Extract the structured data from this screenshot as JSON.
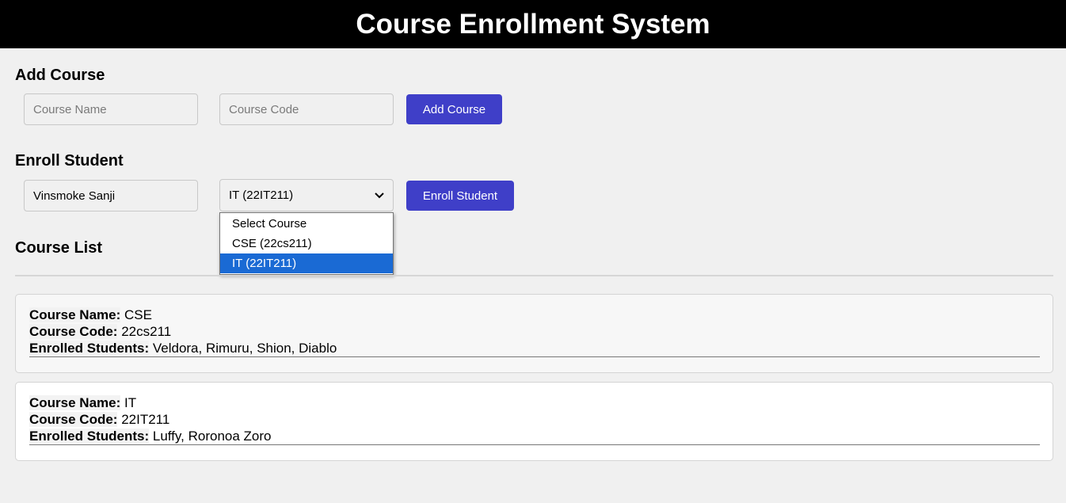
{
  "header": {
    "title": "Course Enrollment System"
  },
  "add_course": {
    "heading": "Add Course",
    "course_name_placeholder": "Course Name",
    "course_code_placeholder": "Course Code",
    "button_label": "Add Course"
  },
  "enroll": {
    "heading": "Enroll Student",
    "student_name_value": "Vinsmoke Sanji",
    "selected_course": "IT (22IT211)",
    "options": [
      "Select Course",
      "CSE (22cs211)",
      "IT (22IT211)"
    ],
    "button_label": "Enroll Student"
  },
  "course_list": {
    "heading": "Course List",
    "labels": {
      "name": "Course Name:",
      "code": "Course Code:",
      "students": "Enrolled Students:"
    },
    "courses": [
      {
        "name": "CSE",
        "code": "22cs211",
        "students": "Veldora, Rimuru, Shion, Diablo"
      },
      {
        "name": "IT",
        "code": "22IT211",
        "students": "Luffy, Roronoa Zoro"
      }
    ]
  },
  "colors": {
    "header_bg": "#000000",
    "page_bg": "#f0f0f0",
    "button_bg": "#3f3fc8",
    "selected_option_bg": "#1a6ad4",
    "card1_bg": "#f7f7f7",
    "card2_bg": "#ffffff"
  },
  "icons": {
    "select_arrow": "chevron-down-icon"
  }
}
